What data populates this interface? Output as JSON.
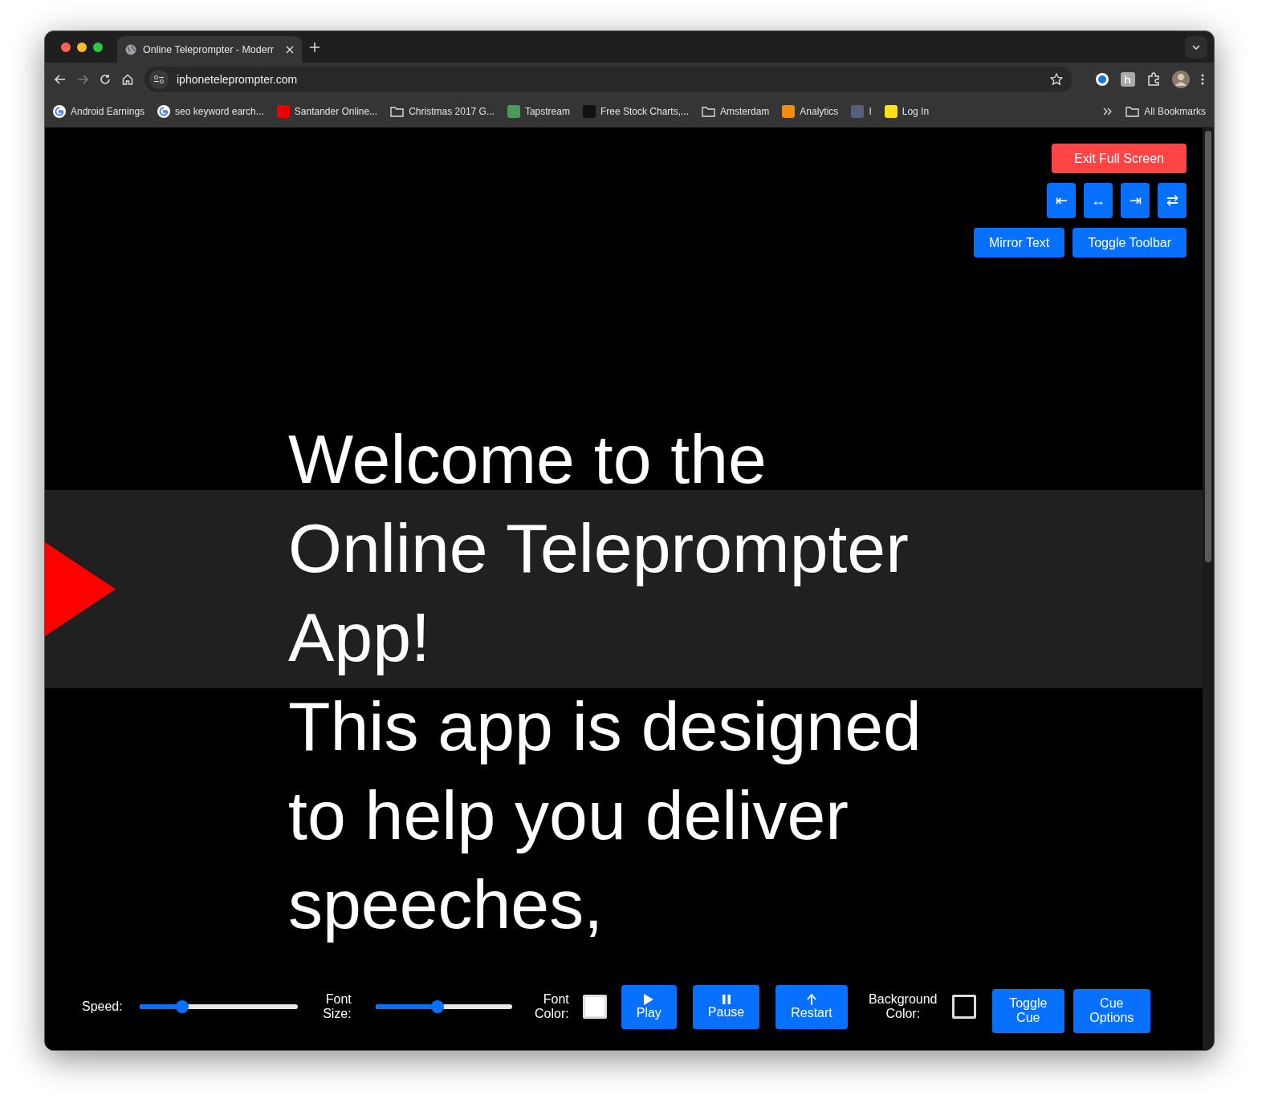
{
  "browser": {
    "tab": {
      "title": "Online Teleprompter - Moderr",
      "selected": true
    },
    "address": "iphoneteleprompter.com",
    "bookmarks": [
      {
        "label": "Android Earnings",
        "kind": "google"
      },
      {
        "label": "seo keyword earch...",
        "kind": "google"
      },
      {
        "label": "Santander Online...",
        "kind": "site",
        "color": "#ec0000"
      },
      {
        "label": "Christmas 2017 G...",
        "kind": "folder"
      },
      {
        "label": "Tapstream",
        "kind": "site",
        "color": "#4a9a5a"
      },
      {
        "label": "Free Stock Charts,...",
        "kind": "site",
        "color": "#111111"
      },
      {
        "label": "Amsterdam",
        "kind": "folder"
      },
      {
        "label": "Analytics",
        "kind": "site",
        "color": "#f28c0f"
      },
      {
        "label": "I",
        "kind": "site",
        "color": "#56607a"
      },
      {
        "label": "Log In",
        "kind": "site",
        "color": "#ffe01b"
      }
    ],
    "all_bookmarks": "All Bookmarks"
  },
  "prompter": {
    "script_lines": [
      "Welcome to the",
      "Online Teleprompter",
      "App!",
      "This app is designed",
      "to help you deliver",
      "speeches,"
    ],
    "cue": {
      "visible": true
    },
    "exit_button": "Exit Full Screen",
    "align_buttons": [
      "⇤",
      "↔",
      "⇥",
      "⇄"
    ],
    "mirror_button": "Mirror Text",
    "toolbar_button": "Toggle Toolbar"
  },
  "toolbar": {
    "speed": {
      "label": "Speed:",
      "level": 0.25
    },
    "font_size": {
      "label": "Font Size:",
      "level": 0.45
    },
    "font_color": {
      "label": "Font Color:",
      "color": "#ffffff"
    },
    "actions": [
      {
        "label": "Play",
        "kind": "play"
      },
      {
        "label": "Pause",
        "kind": "pause"
      },
      {
        "label": "Restart",
        "kind": "restart"
      }
    ],
    "background_color": {
      "label": "Background Color:",
      "color": "#000000"
    },
    "cue_buttons": [
      "Toggle Cue",
      "Cue Options"
    ]
  }
}
